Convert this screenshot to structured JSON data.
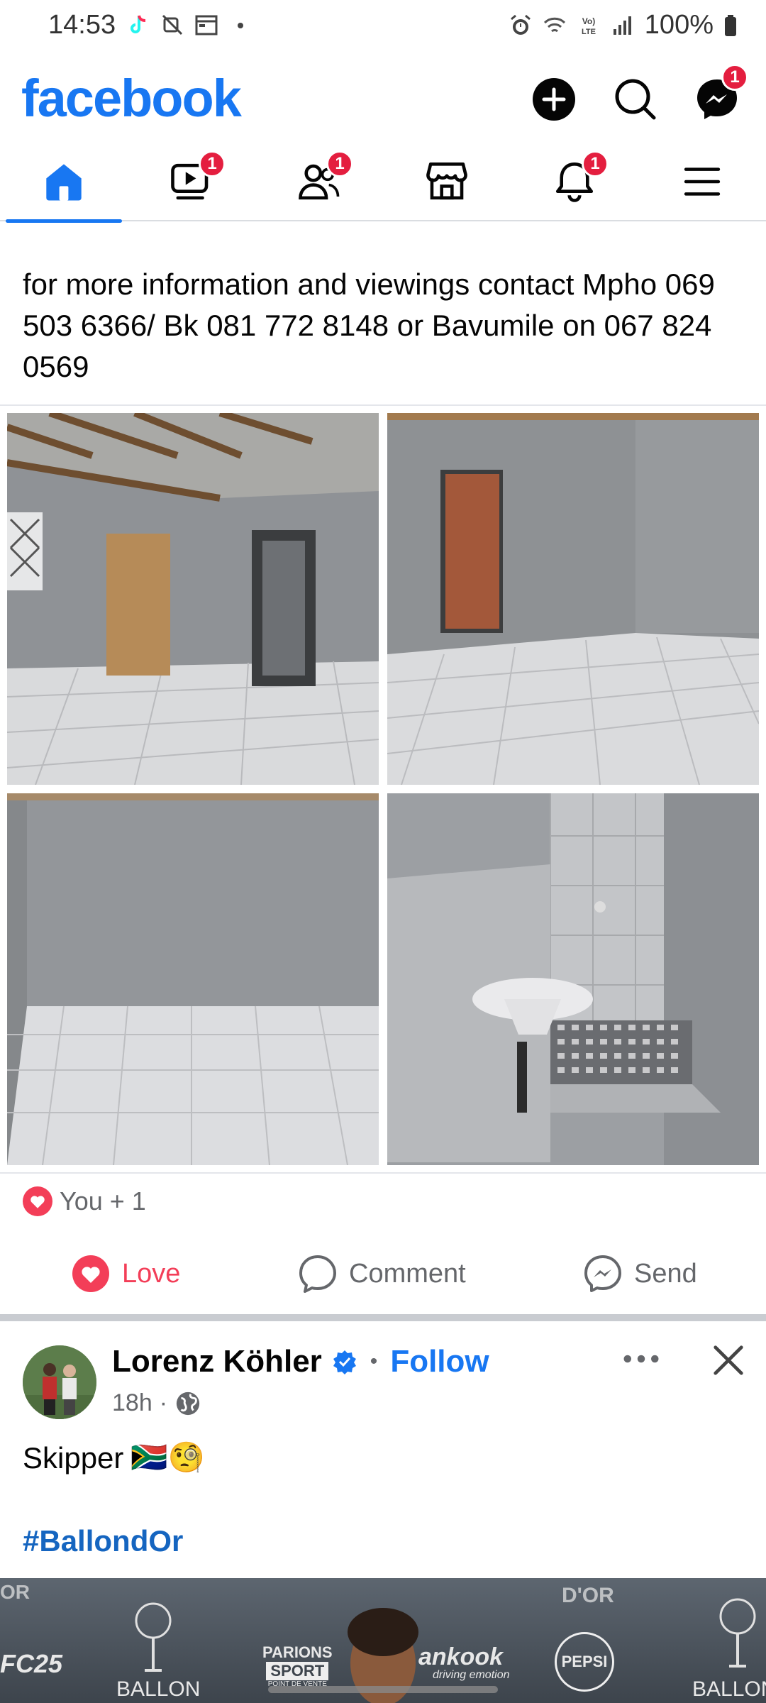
{
  "status_bar": {
    "time": "14:53",
    "battery": "100%",
    "left_icons": [
      "tiktok-icon",
      "no-signal-icon",
      "calendar-icon",
      "dot-icon"
    ],
    "right_icons": [
      "alarm-icon",
      "wifi-icon",
      "volte-icon",
      "signal-icon",
      "battery-icon"
    ]
  },
  "header": {
    "logo": "facebook",
    "messenger_badge": "1"
  },
  "tabs": [
    {
      "name": "home",
      "badge": ""
    },
    {
      "name": "watch",
      "badge": "1"
    },
    {
      "name": "friends",
      "badge": "1"
    },
    {
      "name": "marketplace",
      "badge": ""
    },
    {
      "name": "notifications",
      "badge": "1"
    },
    {
      "name": "menu",
      "badge": ""
    }
  ],
  "post1": {
    "text": "for more information and viewings contact Mpho 069 503 6366/ Bk 081 772 8148 or Bavumile on 067 824 0569",
    "reactions": "You + 1",
    "actions": {
      "love": "Love",
      "comment": "Comment",
      "send": "Send"
    }
  },
  "post2": {
    "author": "Lorenz Köhler",
    "separator": "•",
    "follow": "Follow",
    "time": "18h",
    "meta_dot": "·",
    "caption": "Skipper",
    "caption_emojis": "🇿🇦🧐",
    "hashtag": "#BallondOr",
    "banner": {
      "brand_left": "FC25",
      "ballon_left": "BALLON",
      "ballon_right": "BALLON",
      "dor_left": "OR",
      "dor_center": "D'OR",
      "parions_line1": "PARIONS",
      "parions_line2": "SPORT",
      "parions_line3": "POINT DE VENTE",
      "hankook": "ankook",
      "hankook_sub": "driving emotion",
      "pepsi": "PEPSI"
    }
  },
  "colors": {
    "brand_blue": "#1877f2",
    "badge_red": "#e41e3f",
    "love_red": "#f33e58",
    "secondary_text": "#65676b"
  }
}
